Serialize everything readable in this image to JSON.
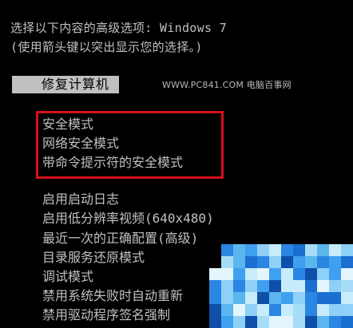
{
  "header": {
    "line1": "选择以下内容的高级选项: Windows 7",
    "line2": "(使用箭头键以突出显示您的选择。)"
  },
  "repair": {
    "label": "修复计算机"
  },
  "watermark": {
    "text": "WWW.PC841.COM 电脑百事网"
  },
  "safe_mode_group": {
    "highlight_color": "#d4101a",
    "items": [
      "安全模式",
      "网络安全模式",
      "带命令提示符的安全模式"
    ]
  },
  "other_options": [
    "启用启动日志",
    "启用低分辨率视频(640x480)",
    "最近一次的正确配置(高级)",
    "目录服务还原模式",
    "调试模式",
    "禁用系统失败时自动重新",
    "禁用驱动程序签名强制"
  ],
  "colors": {
    "background": "#000000",
    "text": "#c0c0c0",
    "selection_background": "#c0c0c0"
  }
}
